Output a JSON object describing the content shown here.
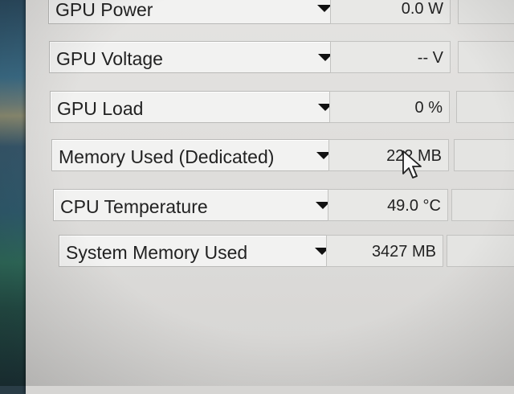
{
  "sensors": [
    {
      "label": "GPU Power",
      "value": "0.0 W"
    },
    {
      "label": "GPU Voltage",
      "value": "-- V"
    },
    {
      "label": "GPU Load",
      "value": "0 %"
    },
    {
      "label": "Memory Used (Dedicated)",
      "value": "222 MB"
    },
    {
      "label": "CPU Temperature",
      "value": "49.0 °C"
    },
    {
      "label": "System Memory Used",
      "value": "3427 MB"
    }
  ],
  "icons": {
    "dropdown": "chevron-down-icon",
    "cursor": "mouse-pointer-icon"
  }
}
